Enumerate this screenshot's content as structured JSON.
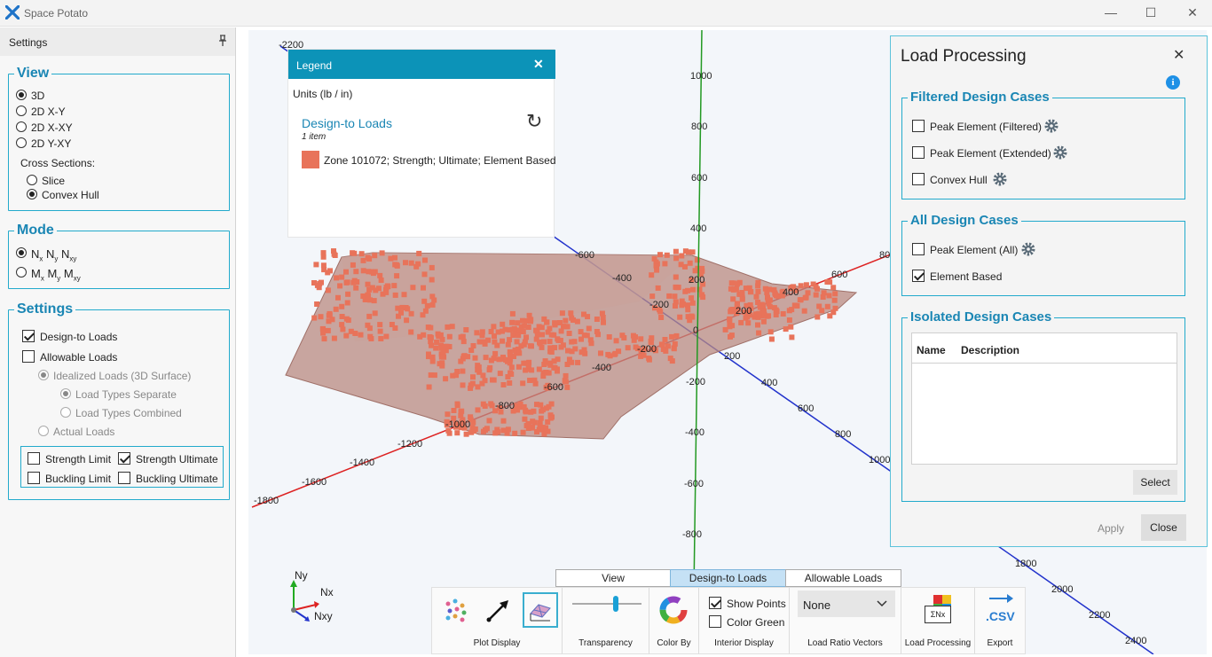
{
  "window": {
    "title": "Space Potato",
    "minimize": "—",
    "maximize": "☐",
    "close": "✕"
  },
  "settings_panel": {
    "title": "Settings",
    "view": {
      "title": "View",
      "options": [
        "3D",
        "2D X-Y",
        "2D X-XY",
        "2D Y-XY"
      ],
      "selected": "3D",
      "cross_sections_label": "Cross Sections:",
      "cross_sections": [
        "Slice",
        "Convex Hull"
      ],
      "cross_selected": "Convex Hull"
    },
    "mode": {
      "title": "Mode",
      "opt1": {
        "a": "N",
        "as": "x",
        "b": " N",
        "bs": "y",
        "c": " N",
        "cs": "xy"
      },
      "opt2": {
        "a": "M",
        "as": "x",
        "b": " M",
        "bs": "y",
        "c": " M",
        "cs": "xy"
      }
    },
    "settings": {
      "title": "Settings",
      "design_to_loads": "Design-to Loads",
      "allowable_loads": "Allowable Loads",
      "idealized": "Idealized Loads (3D Surface)",
      "separate": "Load Types Separate",
      "combined": "Load Types Combined",
      "actual": "Actual Loads",
      "strength_limit": "Strength Limit",
      "strength_ultimate": "Strength Ultimate",
      "buckling_limit": "Buckling Limit",
      "buckling_ultimate": "Buckling Ultimate"
    }
  },
  "legend": {
    "title": "Legend",
    "close": "✕",
    "units": "Units (lb / in)",
    "section": "Design-to Loads",
    "count": "1 item",
    "refresh": "↻",
    "item": "Zone 101072; Strength; Ultimate; Element Based",
    "item_color": "#e8735a"
  },
  "load_processing": {
    "title": "Load Processing",
    "close": "✕",
    "info": "i",
    "filtered": {
      "title": "Filtered Design Cases",
      "items": [
        "Peak Element (Filtered)",
        "Peak Element (Extended)",
        "Convex Hull"
      ]
    },
    "all": {
      "title": "All Design Cases",
      "items": [
        "Peak Element (All)",
        "Element Based"
      ]
    },
    "isolated": {
      "title": "Isolated Design Cases",
      "col_name": "Name",
      "col_desc": "Description",
      "select": "Select"
    },
    "apply": "Apply",
    "close_button": "Close"
  },
  "tabs": [
    "View",
    "Design-to Loads",
    "Allowable Loads"
  ],
  "toolbar": {
    "plot_display": "Plot Display",
    "transparency": "Transparency",
    "color_by": "Color By",
    "show_points": "Show Points",
    "color_green": "Color Green",
    "interior_display": "Interior Display",
    "load_ratio_select": "None",
    "load_ratio_vectors": "Load Ratio Vectors",
    "load_processing": "Load Processing",
    "export": "Export",
    "csv": ".CSV",
    "sum_label": "ΣNx"
  },
  "axes": {
    "triad": {
      "ny": "Ny",
      "nx": "Nx",
      "nxy": "Nxy"
    },
    "green_ticks": [
      "1000",
      "800",
      "600",
      "400",
      "200",
      "0",
      "-200",
      "-400",
      "-600",
      "-800"
    ],
    "blue_ticks_upper": [
      "-2200",
      "-1800",
      "-1600",
      "-1400",
      "-1200",
      "-1000",
      "-800",
      "-600",
      "-400",
      "-200"
    ],
    "blue_ticks_lower": [
      "200",
      "400",
      "600",
      "800",
      "1000",
      "1800",
      "2000",
      "2200",
      "2400"
    ],
    "red_ticks": [
      "-1800",
      "-1600",
      "-1400",
      "-1200",
      "-1000",
      "-800",
      "-600",
      "-400",
      "-200",
      "200",
      "400",
      "600",
      "80"
    ]
  }
}
